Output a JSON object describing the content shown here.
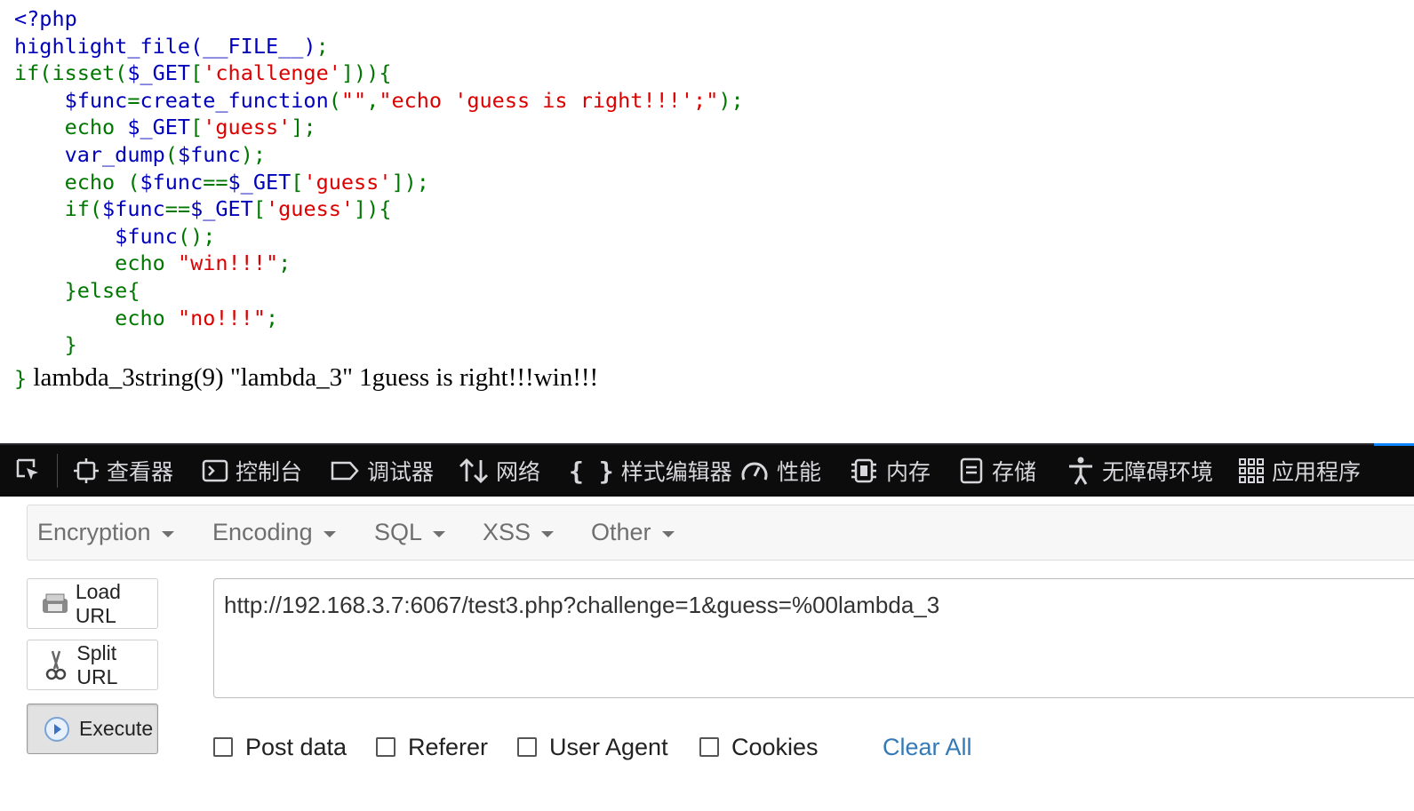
{
  "code": {
    "lines": [
      [
        {
          "t": "<?php",
          "c": "def"
        }
      ],
      [
        {
          "t": "highlight_file(__FILE__)",
          "c": "def"
        },
        {
          "t": ";",
          "c": "kw"
        }
      ],
      [
        {
          "t": "if(isset(",
          "c": "kw"
        },
        {
          "t": "$_GET",
          "c": "def"
        },
        {
          "t": "[",
          "c": "kw"
        },
        {
          "t": "'challenge'",
          "c": "str"
        },
        {
          "t": "])){",
          "c": "kw"
        }
      ],
      [
        {
          "t": "    ",
          "c": "kw"
        },
        {
          "t": "$func",
          "c": "def"
        },
        {
          "t": "=",
          "c": "kw"
        },
        {
          "t": "create_function",
          "c": "def"
        },
        {
          "t": "(",
          "c": "kw"
        },
        {
          "t": "\"\"",
          "c": "str"
        },
        {
          "t": ",",
          "c": "kw"
        },
        {
          "t": "\"echo 'guess is right!!!';\"",
          "c": "str"
        },
        {
          "t": ");",
          "c": "kw"
        }
      ],
      [
        {
          "t": "    echo ",
          "c": "kw"
        },
        {
          "t": "$_GET",
          "c": "def"
        },
        {
          "t": "[",
          "c": "kw"
        },
        {
          "t": "'guess'",
          "c": "str"
        },
        {
          "t": "];",
          "c": "kw"
        }
      ],
      [
        {
          "t": "    ",
          "c": "kw"
        },
        {
          "t": "var_dump",
          "c": "def"
        },
        {
          "t": "(",
          "c": "kw"
        },
        {
          "t": "$func",
          "c": "def"
        },
        {
          "t": ");",
          "c": "kw"
        }
      ],
      [
        {
          "t": "    echo (",
          "c": "kw"
        },
        {
          "t": "$func",
          "c": "def"
        },
        {
          "t": "==",
          "c": "kw"
        },
        {
          "t": "$_GET",
          "c": "def"
        },
        {
          "t": "[",
          "c": "kw"
        },
        {
          "t": "'guess'",
          "c": "str"
        },
        {
          "t": "]);",
          "c": "kw"
        }
      ],
      [
        {
          "t": "    if(",
          "c": "kw"
        },
        {
          "t": "$func",
          "c": "def"
        },
        {
          "t": "==",
          "c": "kw"
        },
        {
          "t": "$_GET",
          "c": "def"
        },
        {
          "t": "[",
          "c": "kw"
        },
        {
          "t": "'guess'",
          "c": "str"
        },
        {
          "t": "]){",
          "c": "kw"
        }
      ],
      [
        {
          "t": "        ",
          "c": "kw"
        },
        {
          "t": "$func",
          "c": "def"
        },
        {
          "t": "();",
          "c": "kw"
        }
      ],
      [
        {
          "t": "        echo ",
          "c": "kw"
        },
        {
          "t": "\"win!!!\"",
          "c": "str"
        },
        {
          "t": ";",
          "c": "kw"
        }
      ],
      [
        {
          "t": "    }else{",
          "c": "kw"
        }
      ],
      [
        {
          "t": "        echo ",
          "c": "kw"
        },
        {
          "t": "\"no!!!\"",
          "c": "str"
        },
        {
          "t": ";",
          "c": "kw"
        }
      ],
      [
        {
          "t": "    }",
          "c": "kw"
        }
      ]
    ],
    "closing_brace": "}",
    "output": " lambda_3string(9) \"lambda_3\" 1guess is right!!!win!!!"
  },
  "colors": {
    "def": "#0000BB",
    "kw": "#007700",
    "str": "#DD0000"
  },
  "devtools": {
    "tabs": [
      {
        "label": "查看器",
        "icon": "inspector-icon"
      },
      {
        "label": "控制台",
        "icon": "console-icon"
      },
      {
        "label": "调试器",
        "icon": "debugger-icon"
      },
      {
        "label": "网络",
        "icon": "network-icon"
      },
      {
        "label": "样式编辑器",
        "icon": "style-editor-icon"
      },
      {
        "label": "性能",
        "icon": "performance-icon"
      },
      {
        "label": "内存",
        "icon": "memory-icon"
      },
      {
        "label": "存储",
        "icon": "storage-icon"
      },
      {
        "label": "无障碍环境",
        "icon": "accessibility-icon"
      },
      {
        "label": "应用程序",
        "icon": "application-icon"
      }
    ]
  },
  "hackbar": {
    "menu": [
      "Encryption",
      "Encoding",
      "SQL",
      "XSS",
      "Other"
    ],
    "buttons": {
      "load": "Load URL",
      "split": "Split URL",
      "execute": "Execute"
    },
    "url": "http://192.168.3.7:6067/test3.php?challenge=1&guess=%00lambda_3",
    "checkboxes": [
      "Post data",
      "Referer",
      "User Agent",
      "Cookies"
    ],
    "clear_all": "Clear All"
  }
}
